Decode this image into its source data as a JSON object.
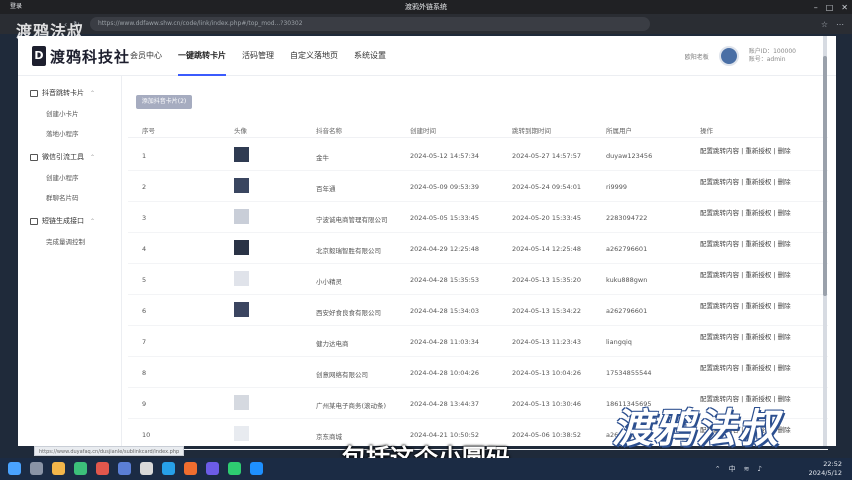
{
  "browser": {
    "tab_label": "登录",
    "window_title": "渡鸦外链系统",
    "url": "https://www.ddfaww.shw.cn/code/link/index.php#/top_mod...?30302",
    "status_url": "https://www.duyafaq.cn/dusjianle/sublinkcard/index.php"
  },
  "overlay": {
    "top_left_watermark": "渡鸦法叔",
    "caption": "包括这个小圆码",
    "brand_watermark": "渡鸦法叔"
  },
  "header": {
    "logo_text": "渡鸦科技社",
    "menu": [
      "会员中心",
      "一键跳转卡片",
      "活码管理",
      "自定义落地页",
      "系统设置"
    ],
    "active_menu_index": 1,
    "user_name": "欧阳老板",
    "user_id_line": "账户ID：100000",
    "user_account_line": "账号：admin"
  },
  "sidebar": {
    "groups": [
      {
        "label": "抖音跳转卡片",
        "items": [
          "创建小卡片",
          "落地小程序"
        ]
      },
      {
        "label": "微信引流工具",
        "items": [
          "创建小程序",
          "群聊名片码"
        ]
      },
      {
        "label": "短链生成接口",
        "items": [
          "完成量调控制"
        ]
      }
    ]
  },
  "main": {
    "add_button": "添加抖音卡片(2)",
    "columns": [
      "序号",
      "头像",
      "抖音名称",
      "创建时间",
      "跳转到期时间",
      "所属用户",
      "操作"
    ],
    "rows": [
      {
        "no": "1",
        "name": "金牛",
        "created": "2024-05-12 14:57:34",
        "expires": "2024-05-27 14:57:57",
        "user": "duyaw123456",
        "actions": "配置跳转内容 | 重新授权 | 删除",
        "avatar_color": "#2f3b52"
      },
      {
        "no": "2",
        "name": "百年通",
        "created": "2024-05-09 09:53:39",
        "expires": "2024-05-24 09:54:01",
        "user": "ri9999",
        "actions": "配置跳转内容 | 重新授权 | 删除",
        "avatar_color": "#3a4660"
      },
      {
        "no": "3",
        "name": "宁波诚电商管理有限公司",
        "created": "2024-05-05 15:33:45",
        "expires": "2024-05-20 15:33:45",
        "user": "2283094722",
        "actions": "配置跳转内容 | 重新授权 | 删除",
        "avatar_color": "#c9ced8"
      },
      {
        "no": "4",
        "name": "北京毅瑞智胜有限公司",
        "created": "2024-04-29 12:25:48",
        "expires": "2024-05-14 12:25:48",
        "user": "a262796601",
        "actions": "配置跳转内容 | 重新授权 | 删除",
        "avatar_color": "#2a3346"
      },
      {
        "no": "5",
        "name": "小小精灵",
        "created": "2024-04-28 15:35:53",
        "expires": "2024-05-13 15:35:20",
        "user": "kuku888gwn",
        "actions": "配置跳转内容 | 重新授权 | 删除",
        "avatar_color": "#e0e3ea"
      },
      {
        "no": "6",
        "name": "西安好食良食有限公司",
        "created": "2024-04-28 15:34:03",
        "expires": "2024-05-13 15:34:22",
        "user": "a262796601",
        "actions": "配置跳转内容 | 重新授权 | 删除",
        "avatar_color": "#3b4560"
      },
      {
        "no": "7",
        "name": "健力达电商",
        "created": "2024-04-28 11:03:34",
        "expires": "2024-05-13 11:23:43",
        "user": "liangqiq",
        "actions": "配置跳转内容 | 重新授权 | 删除",
        "avatar_color": "#ffffff"
      },
      {
        "no": "8",
        "name": "创意网络有限公司",
        "created": "2024-04-28 10:04:26",
        "expires": "2024-05-13 10:04:26",
        "user": "17534855544",
        "actions": "配置跳转内容 | 重新授权 | 删除",
        "avatar_color": "#ffffff"
      },
      {
        "no": "9",
        "name": "广州某电子商务(滚动条)",
        "created": "2024-04-28 13:44:37",
        "expires": "2024-05-13 10:30:46",
        "user": "18611345695",
        "actions": "配置跳转内容 | 重新授权 | 删除",
        "avatar_color": "#d5d9e0"
      },
      {
        "no": "10",
        "name": "京东商城",
        "created": "2024-04-21 10:50:52",
        "expires": "2024-05-06 10:38:52",
        "user": "a262796601",
        "actions": "配置跳转内容 | 重新授权 | 删除",
        "avatar_color": "#e8ebf0"
      }
    ]
  },
  "taskbar": {
    "tray_lang": "中",
    "time": "22:52",
    "date": "2024/5/12"
  },
  "colors": {
    "accent": "#3b5bfd",
    "taskbar": "#1b2b44",
    "button": "#a6acc0"
  }
}
